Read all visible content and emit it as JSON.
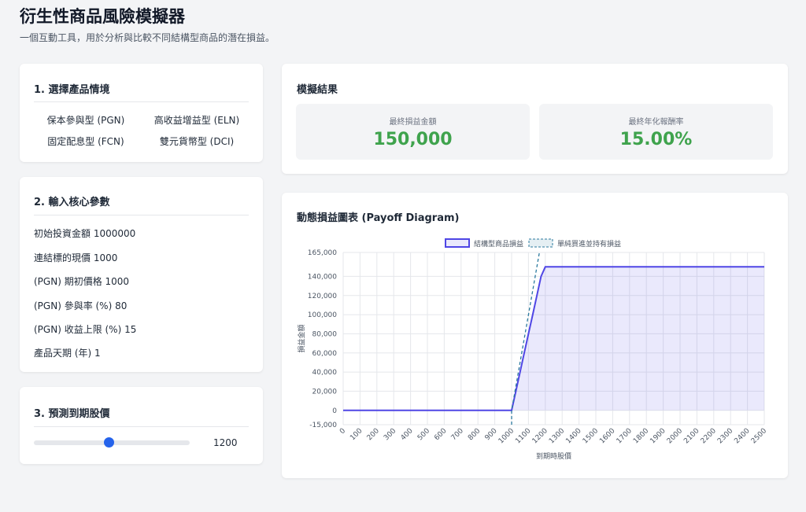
{
  "header": {
    "title": "衍生性商品風險模擬器",
    "subtitle": "一個互動工具，用於分析與比較不同結構型商品的潛在損益。"
  },
  "scenario": {
    "title": "1. 選擇產品情境",
    "options": [
      "保本參與型 (PGN)",
      "高收益增益型 (ELN)",
      "固定配息型 (FCN)",
      "雙元貨幣型 (DCI)"
    ]
  },
  "params": {
    "title": "2. 輸入核心參數",
    "items": [
      "初始投資金額 1000000",
      "連結標的現價 1000",
      "(PGN) 期初價格 1000",
      "(PGN) 參與率 (%) 80",
      "(PGN) 收益上限 (%) 15",
      "產品天期 (年) 1"
    ]
  },
  "forecast": {
    "title": "3. 預測到期股價",
    "value": "1200",
    "fraction": 0.48
  },
  "results": {
    "title": "模擬結果",
    "pnl_label": "最終損益金額",
    "pnl_value": "150,000",
    "return_label": "最終年化報酬率",
    "return_value": "15.00%",
    "value_color": "#3fa34d"
  },
  "chart_card": {
    "title": "動態損益圖表 (Payoff Diagram)"
  },
  "chart_data": {
    "type": "line",
    "xlabel": "到期時股價",
    "ylabel": "損益金額",
    "xlim": [
      0,
      2500
    ],
    "ylim": [
      -15000,
      165000
    ],
    "x_ticks": [
      "0",
      "100",
      "200",
      "300",
      "400",
      "500",
      "600",
      "700",
      "800",
      "900",
      "1000",
      "1100",
      "1200",
      "1300",
      "1400",
      "1500",
      "1600",
      "1700",
      "1800",
      "1900",
      "2000",
      "2100",
      "2200",
      "2300",
      "2400",
      "2500"
    ],
    "y_ticks": [
      "165,000",
      "140,000",
      "120,000",
      "100,000",
      "80,000",
      "60,000",
      "40,000",
      "20,000",
      "0",
      "-15,000"
    ],
    "legend_position": "top-center",
    "grid": true,
    "series": [
      {
        "name": "結構型商品損益",
        "color": "#4f46e5",
        "fill": true,
        "points": [
          [
            0,
            0
          ],
          [
            1000,
            0
          ],
          [
            1025,
            20000
          ],
          [
            1050,
            40000
          ],
          [
            1075,
            60000
          ],
          [
            1100,
            80000
          ],
          [
            1125,
            100000
          ],
          [
            1150,
            120000
          ],
          [
            1175,
            140000
          ],
          [
            1200,
            150000
          ],
          [
            1300,
            150000
          ],
          [
            2500,
            150000
          ]
        ]
      },
      {
        "name": "單純買進並持有損益",
        "color": "#2b7a9e",
        "dashed": true,
        "points": [
          [
            1000,
            -15000
          ],
          [
            1000,
            0
          ],
          [
            1100,
            100000
          ],
          [
            1165,
            165000
          ]
        ]
      }
    ]
  }
}
